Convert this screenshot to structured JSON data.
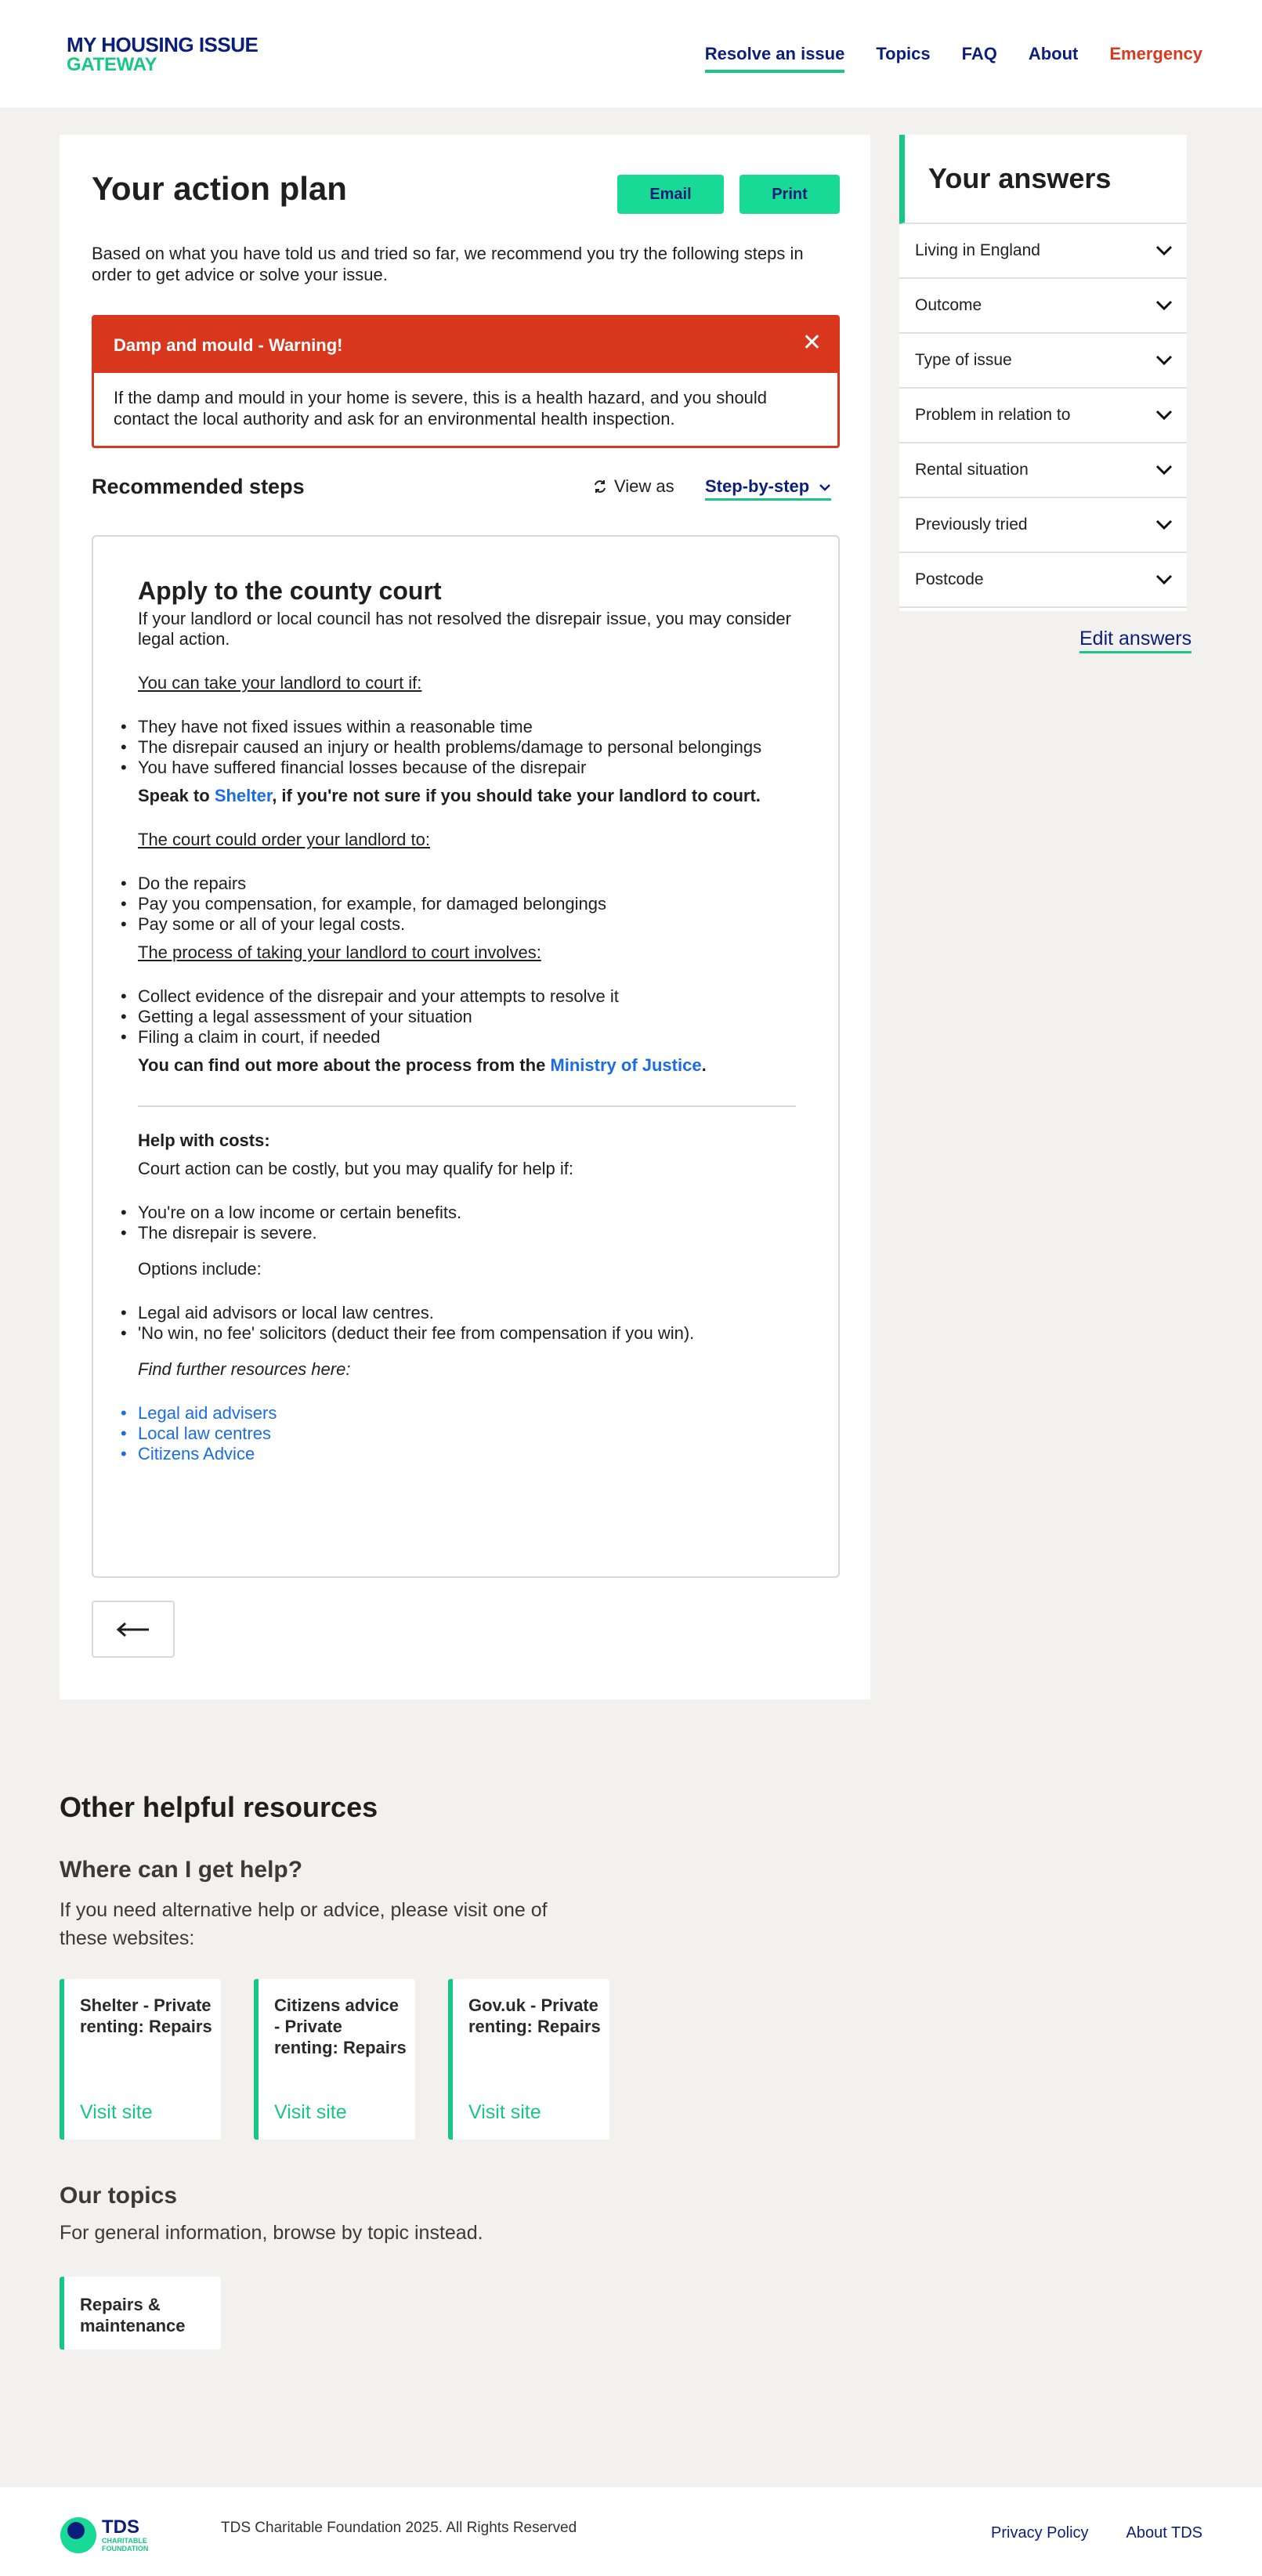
{
  "header": {
    "logo_line1": "MY HOUSING ISSUE",
    "logo_line2": "GATEWAY",
    "nav": [
      {
        "label": "Resolve an issue",
        "active": true
      },
      {
        "label": "Topics"
      },
      {
        "label": "FAQ"
      },
      {
        "label": "About"
      },
      {
        "label": "Emergency"
      }
    ]
  },
  "plan": {
    "title": "Your action plan",
    "email_label": "Email",
    "print_label": "Print",
    "intro": "Based on what you have told us and tried so far, we recommend you try the following steps in order to get advice or solve your issue.",
    "warning": {
      "title": "Damp and mould - Warning!",
      "body": "If the damp and mould in your home is severe, this is a health hazard, and you should contact the local authority and ask for an environmental health inspection."
    },
    "recommended_heading": "Recommended steps",
    "view_as_label": "View as",
    "view_mode": "Step-by-step"
  },
  "step": {
    "title": "Apply to the county court",
    "intro": "If your landlord or local council has not resolved the disrepair issue, you may consider legal action.",
    "court_if_heading": "You can take your landlord to court if:",
    "court_if_items": [
      "They have not fixed issues within a reasonable time",
      "The disrepair caused an injury or health problems/damage to personal belongings",
      "You have suffered financial losses because of the disrepair"
    ],
    "speak_pre": "Speak to ",
    "speak_link": "Shelter",
    "speak_post": ", if you're not sure if you should take your landlord to court.",
    "order_heading": "The court could order your landlord to:",
    "order_items": [
      "Do the repairs",
      "Pay you compensation, for example, for damaged belongings",
      "Pay some or all of your legal costs."
    ],
    "process_heading": "The process of taking your landlord to court involves:",
    "process_items": [
      "Collect evidence of the disrepair and your attempts to resolve it",
      "Getting a legal assessment of your situation",
      "Filing a claim in court, if needed"
    ],
    "moj_pre": "You can find out more about the process from the ",
    "moj_link": "Ministry of Justice",
    "moj_post": ".",
    "costs_heading": "Help with costs:",
    "costs_intro": "Court action can be costly, but you may qualify for help if:",
    "costs_items": [
      "You're on a low income or certain benefits.",
      "The disrepair is severe."
    ],
    "options_label": "Options include:",
    "options_items": [
      "Legal aid advisors or local law centres.",
      "'No win, no fee' solicitors (deduct their fee from compensation if you win)."
    ],
    "further_label": "Find further resources here:",
    "further_links": [
      "Legal aid advisers",
      "Local law centres",
      "Citizens Advice"
    ]
  },
  "answers": {
    "title": "Your answers",
    "items": [
      "Living in England",
      "Outcome",
      "Type of issue",
      "Problem in relation to",
      "Rental situation",
      "Previously tried",
      "Postcode"
    ],
    "edit_label": "Edit answers"
  },
  "resources": {
    "title": "Other helpful resources",
    "help_heading": "Where can I get help?",
    "help_desc": "If you need alternative help or advice, please visit one of these websites:",
    "cards": [
      {
        "title": "Shelter - Private renting: Repairs",
        "link": "Visit site"
      },
      {
        "title": "Citizens advice - Private renting: Repairs",
        "link": "Visit site"
      },
      {
        "title": "Gov.uk - Private renting: Repairs",
        "link": "Visit site"
      }
    ],
    "topics_heading": "Our topics",
    "topics_desc": "For general information, browse by topic instead.",
    "topic_card": "Repairs & maintenance"
  },
  "footer": {
    "logo_text": "TDS",
    "logo_sub1": "CHARITABLE",
    "logo_sub2": "FOUNDATION",
    "copyright": "TDS Charitable Foundation 2025. All Rights Reserved",
    "links": [
      "Privacy Policy",
      "About TDS"
    ]
  },
  "colors": {
    "brand_navy": "#0b1f7a",
    "brand_green": "#19c784",
    "button_green": "#19d996",
    "warning_red": "#d8371e",
    "link_blue": "#1a6ce6",
    "page_bg": "#f2f1ef"
  }
}
